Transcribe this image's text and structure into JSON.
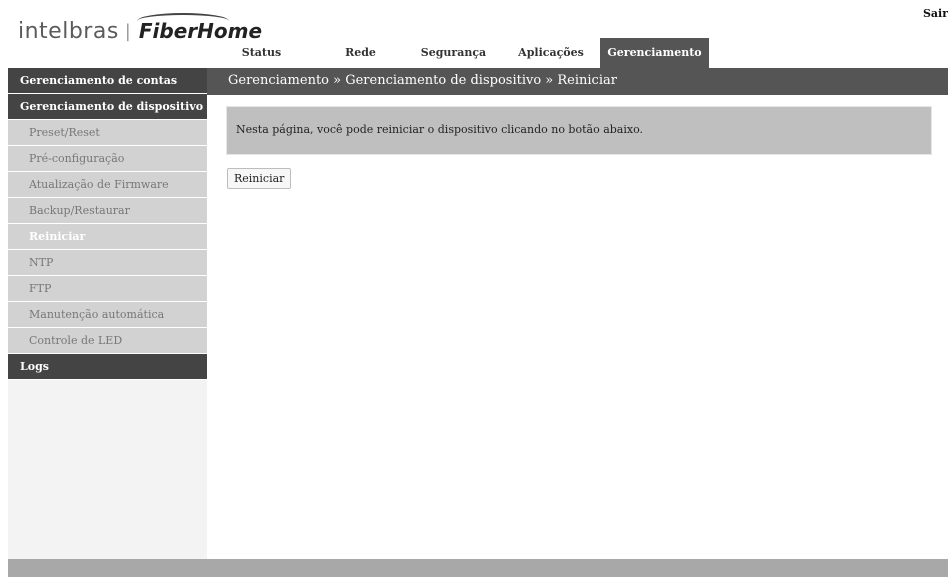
{
  "header": {
    "logo_intelbras": "intelbras",
    "logo_separator": "|",
    "logo_fiberhome": "FiberHome",
    "logout_label": "Sair"
  },
  "topnav": {
    "tabs": [
      {
        "label": "Status"
      },
      {
        "label": "Rede"
      },
      {
        "label": "Segurança"
      },
      {
        "label": "Aplicações"
      },
      {
        "label": "Gerenciamento",
        "active": true
      }
    ]
  },
  "breadcrumb": "Gerenciamento » Gerenciamento de dispositivo » Reiniciar",
  "sidebar": {
    "groups": [
      {
        "label": "Gerenciamento de contas"
      },
      {
        "label": "Gerenciamento de dispositivo"
      },
      {
        "label": "Logs"
      }
    ],
    "items": [
      {
        "label": "Preset/Reset"
      },
      {
        "label": "Pré-configuração"
      },
      {
        "label": "Atualização de Firmware"
      },
      {
        "label": "Backup/Restaurar"
      },
      {
        "label": "Reiniciar",
        "active": true
      },
      {
        "label": "NTP"
      },
      {
        "label": "FTP"
      },
      {
        "label": "Manutenção automática"
      },
      {
        "label": "Controle de LED"
      }
    ]
  },
  "content": {
    "info_text": "Nesta página, você pode reiniciar o dispositivo clicando no botão abaixo.",
    "restart_button": "Reiniciar"
  },
  "colors": {
    "nav_dark": "#555555",
    "sidebar_group": "#444444",
    "sidebar_item": "#d2d2d2",
    "info_box": "#bfbfbf",
    "footer": "#a8a8a8"
  }
}
